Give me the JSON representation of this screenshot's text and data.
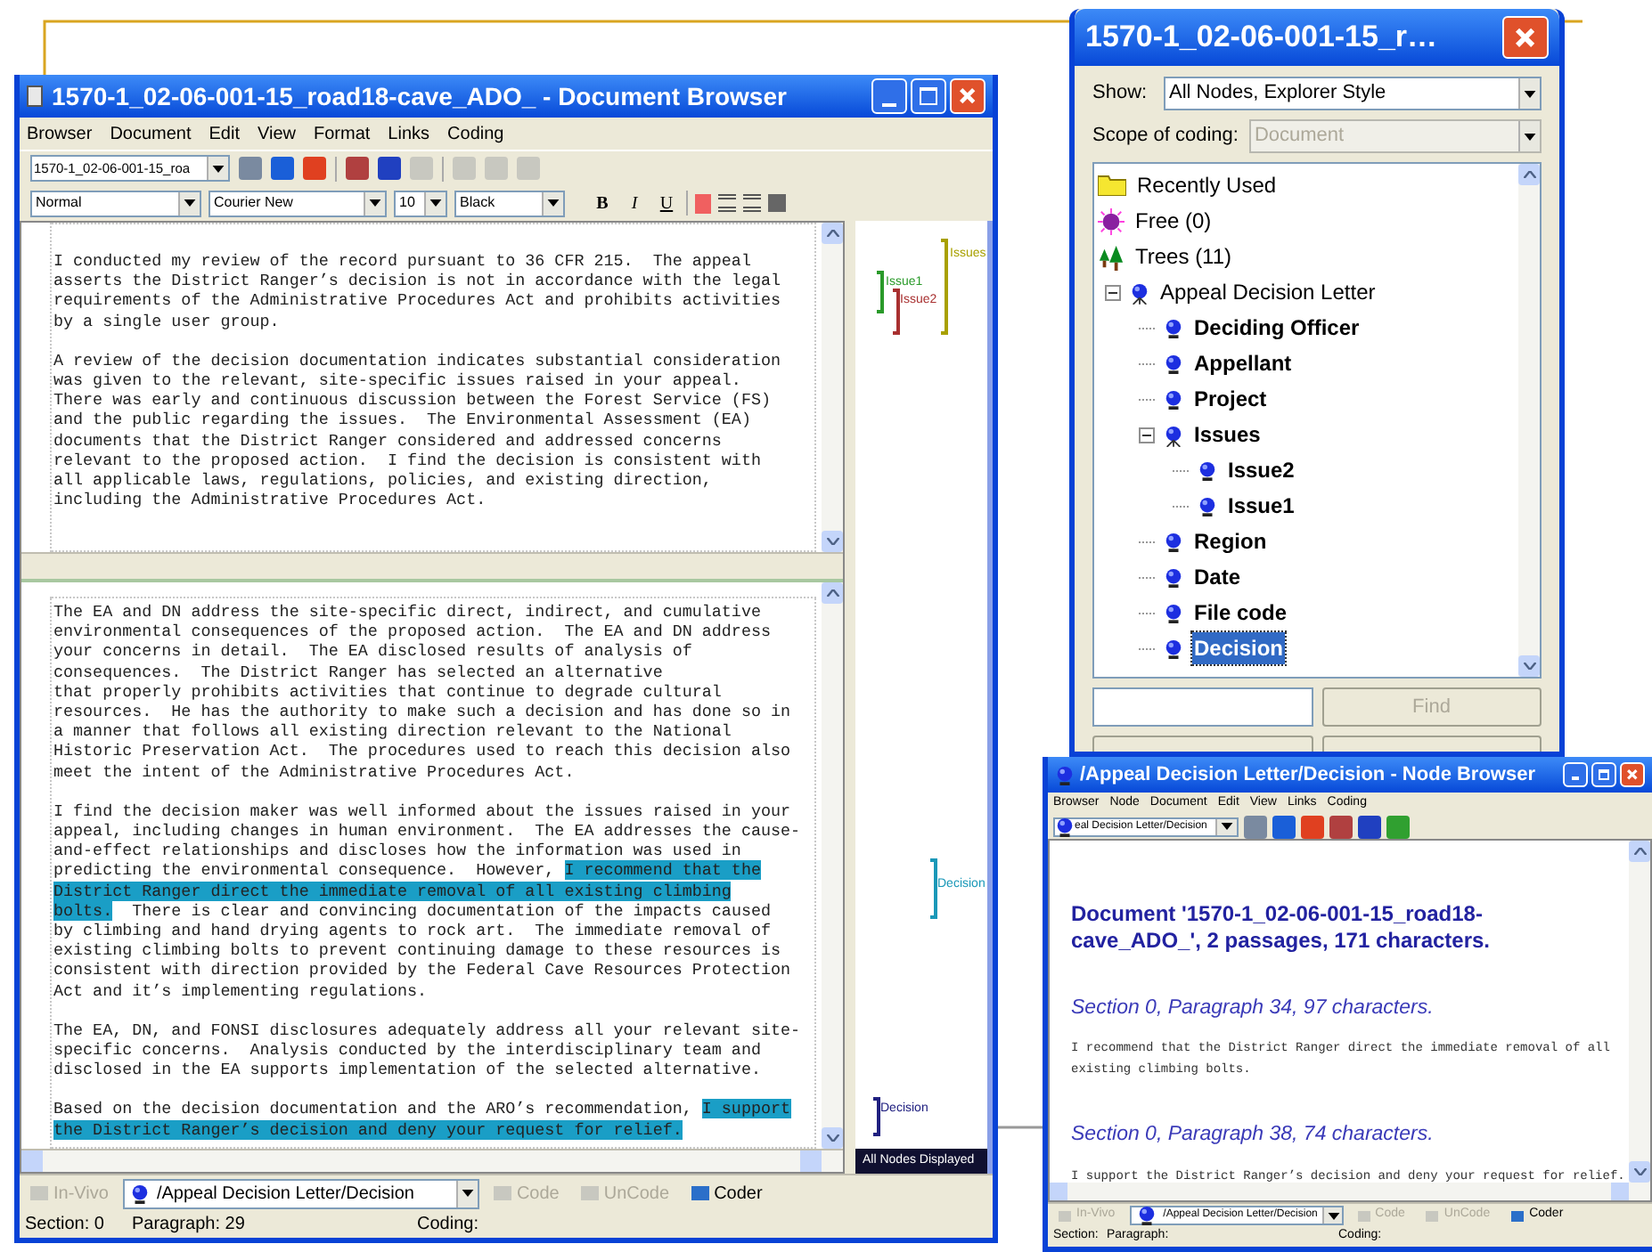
{
  "document_browser": {
    "title": "1570-1_02-06-001-15_road18-cave_ADO_ - Document Browser",
    "menu": [
      "Browser",
      "Document",
      "Edit",
      "View",
      "Format",
      "Links",
      "Coding"
    ],
    "document_combo": "1570-1_02-06-001-15_roa",
    "format_bar": {
      "style": "Normal",
      "font": "Courier New",
      "size": "10",
      "ink": "Black",
      "text_buttons": [
        {
          "label": "B",
          "kind": "bold"
        },
        {
          "label": "I",
          "kind": "italic"
        },
        {
          "label": "U",
          "kind": "underline"
        }
      ]
    },
    "panes": [
      {
        "paragraphs": [
          [
            {
              "text": "I conducted my review of the record pursuant to 36 CFR 215.  The appeal\nasserts the District Ranger’s decision is not in accordance with the legal\nrequirements of the Administrative Procedures Act and prohibits activities\nby a single user group.",
              "highlighted": false
            }
          ],
          [
            {
              "text": "A review of the decision documentation indicates substantial consideration\nwas given to the relevant, site-specific issues raised in your appeal.\nThere was early and continuous discussion between the Forest Service (FS)\nand the public regarding the issues.  The Environmental Assessment (EA)\ndocuments that the District Ranger considered and addressed concerns\nrelevant to the proposed action.  I find the decision is consistent with\nall applicable laws, regulations, policies, and existing direction,\nincluding the Administrative Procedures Act.",
              "highlighted": false
            }
          ]
        ]
      },
      {
        "paragraphs": [
          [
            {
              "text": "The EA and DN address the site-specific direct, indirect, and cumulative\nenvironmental consequences of the proposed action.  The EA and DN address\nyour concerns in detail.  The EA disclosed results of analysis of\nconsequences.  The District Ranger has selected an alternative\nthat properly prohibits activities that continue to degrade cultural\nresources.  He has the authority to make such a decision and has done so in\na manner that follows all existing direction relevant to the National\nHistoric Preservation Act.  The procedures used to reach this decision also\nmeet the intent of the Administrative Procedures Act.",
              "highlighted": false
            }
          ],
          [
            {
              "text": "I find the decision maker was well informed about the issues raised in your\nappeal, including changes in human environment.  The EA addresses the cause-\nand-effect relationships and discloses how the information was used in\npredicting the environmental consequence.  However, ",
              "highlighted": false
            },
            {
              "text": "I recommend that the\nDistrict Ranger direct the immediate removal of all existing climbing\nbolts.",
              "highlighted": true
            },
            {
              "text": "  There is clear and convincing documentation of the impacts caused\nby climbing and hand drying agents to rock art.  The immediate removal of\nexisting climbing bolts to prevent continuing damage to these resources is\nconsistent with direction provided by the Federal Cave Resources Protection\nAct and it’s implementing regulations.",
              "highlighted": false
            }
          ],
          [
            {
              "text": "The EA, DN, and FONSI disclosures adequately address all your relevant site-\nspecific concerns.  Analysis conducted by the interdisciplinary team and\ndisclosed in the EA supports implementation of the selected alternative.",
              "highlighted": false
            }
          ],
          [
            {
              "text": "Based on the decision documentation and the ARO’s recommendation, ",
              "highlighted": false
            },
            {
              "text": "I support\nthe District Ranger’s decision and deny your request for relief.",
              "highlighted": true
            }
          ]
        ]
      }
    ],
    "coding_stripes": [
      {
        "label": "Issues",
        "color": "#a8a000"
      },
      {
        "label": "Issue1",
        "color": "#2a9a2a"
      },
      {
        "label": "Issue2",
        "color": "#a83030"
      },
      {
        "label": "Decision",
        "color": "#1a98b8"
      },
      {
        "label": "Decision",
        "color": "#202080"
      }
    ],
    "stripes_footer": "All Nodes Displayed",
    "coder_bar": {
      "in_vivo": {
        "label": "In-Vivo",
        "disabled": true
      },
      "node": "/Appeal Decision Letter/Decision",
      "code": {
        "label": "Code",
        "disabled": true
      },
      "uncode": {
        "label": "UnCode",
        "disabled": true
      },
      "coder": {
        "label": "Coder",
        "disabled": false
      }
    },
    "status_bar": [
      "Section: 0",
      "Paragraph: 29",
      "Coding:"
    ]
  },
  "coder_window": {
    "title": "1570-1_02-06-001-15_r…",
    "show_label": "Show:",
    "show_value": "All Nodes, Explorer Style",
    "scope_label": "Scope of coding:",
    "scope_value": "Document",
    "scope_disabled": true,
    "tree": [
      {
        "label": "Recently Used",
        "kind": "folder",
        "selected": false
      },
      {
        "label": "Free (0)",
        "kind": "free",
        "selected": false
      },
      {
        "label": "Trees (11)",
        "kind": "trees",
        "selected": false,
        "children": [
          {
            "label": "Appeal Decision Letter",
            "kind": "tree",
            "selected": false,
            "expanded": true,
            "children": [
              {
                "label": "Deciding Officer",
                "kind": "node",
                "selected": false
              },
              {
                "label": "Appellant",
                "kind": "node",
                "selected": false
              },
              {
                "label": "Project",
                "kind": "node",
                "selected": false
              },
              {
                "label": "Issues",
                "kind": "branch",
                "selected": false,
                "expanded": true,
                "children": [
                  {
                    "label": "Issue2",
                    "kind": "node",
                    "selected": false
                  },
                  {
                    "label": "Issue1",
                    "kind": "node",
                    "selected": false
                  }
                ]
              },
              {
                "label": "Region",
                "kind": "node",
                "selected": false
              },
              {
                "label": "Date",
                "kind": "node",
                "selected": false
              },
              {
                "label": "File code",
                "kind": "node",
                "selected": false
              },
              {
                "label": "Decision",
                "kind": "node",
                "selected": true
              }
            ]
          }
        ]
      }
    ],
    "find_button": {
      "label": "Find",
      "disabled": true
    }
  },
  "node_browser": {
    "title": "/Appeal Decision Letter/Decision - Node Browser",
    "menu": [
      "Browser",
      "Node",
      "Document",
      "Edit",
      "View",
      "Links",
      "Coding"
    ],
    "node_combo": "eal Decision Letter/Decision",
    "heading": "Document '1570-1_02-06-001-15_road18-cave_ADO_', 2 passages, 171 characters.",
    "sections": [
      {
        "heading": "Section 0, Paragraph 34, 97 characters.",
        "text": "I recommend that the District Ranger direct the immediate removal of all\nexisting climbing bolts."
      },
      {
        "heading": "Section 0, Paragraph 38, 74 characters.",
        "text": "I support the District Ranger’s decision and deny your request for relief."
      }
    ],
    "coder_bar": {
      "in_vivo": {
        "label": "In-Vivo",
        "disabled": true
      },
      "node": "/Appeal Decision Letter/Decision",
      "code": {
        "label": "Code",
        "disabled": true
      },
      "uncode": {
        "label": "UnCode",
        "disabled": true
      },
      "coder": {
        "label": "Coder",
        "disabled": false
      }
    },
    "status_bar": [
      "Section:",
      "Paragraph:",
      "Coding:"
    ]
  }
}
